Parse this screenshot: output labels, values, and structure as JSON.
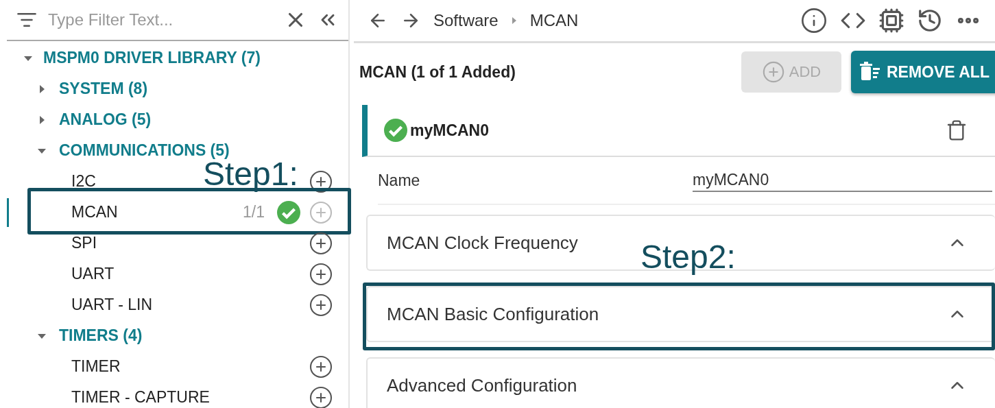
{
  "filter": {
    "placeholder": "Type Filter Text..."
  },
  "tree": {
    "label": "MSPM0 DRIVER LIBRARY (7)",
    "expanded": true,
    "children": [
      {
        "label": "SYSTEM (8)",
        "expanded": false
      },
      {
        "label": "ANALOG (5)",
        "expanded": false
      },
      {
        "label": "COMMUNICATIONS (5)",
        "expanded": true,
        "children": [
          {
            "label": "I2C",
            "selected": false,
            "added": false,
            "add_disabled": false
          },
          {
            "label": "MCAN",
            "selected": true,
            "count": "1/1",
            "added": true,
            "add_disabled": true,
            "annotation": "Step1:"
          },
          {
            "label": "SPI",
            "selected": false,
            "added": false,
            "add_disabled": false
          },
          {
            "label": "UART",
            "selected": false,
            "added": false,
            "add_disabled": false
          },
          {
            "label": "UART - LIN",
            "selected": false,
            "added": false,
            "add_disabled": false
          }
        ]
      },
      {
        "label": "TIMERS (4)",
        "expanded": true,
        "children": [
          {
            "label": "TIMER",
            "selected": false,
            "added": false,
            "add_disabled": false
          },
          {
            "label": "TIMER - CAPTURE",
            "selected": false,
            "added": false,
            "add_disabled": false
          }
        ]
      }
    ]
  },
  "breadcrumb": [
    "Software",
    "MCAN"
  ],
  "module": {
    "title": "MCAN (1 of 1 Added)",
    "add_button": {
      "label": "ADD",
      "disabled": true
    },
    "remove_all": {
      "label": "REMOVE ALL"
    }
  },
  "instance": {
    "name": "myMCAN0",
    "valid": true
  },
  "fields": [
    {
      "label": "Name",
      "value": "myMCAN0"
    }
  ],
  "sections": [
    {
      "title": "MCAN Clock Frequency"
    },
    {
      "title": "MCAN Basic Configuration",
      "annotation": "Step2:"
    },
    {
      "title": "Advanced Configuration"
    }
  ]
}
